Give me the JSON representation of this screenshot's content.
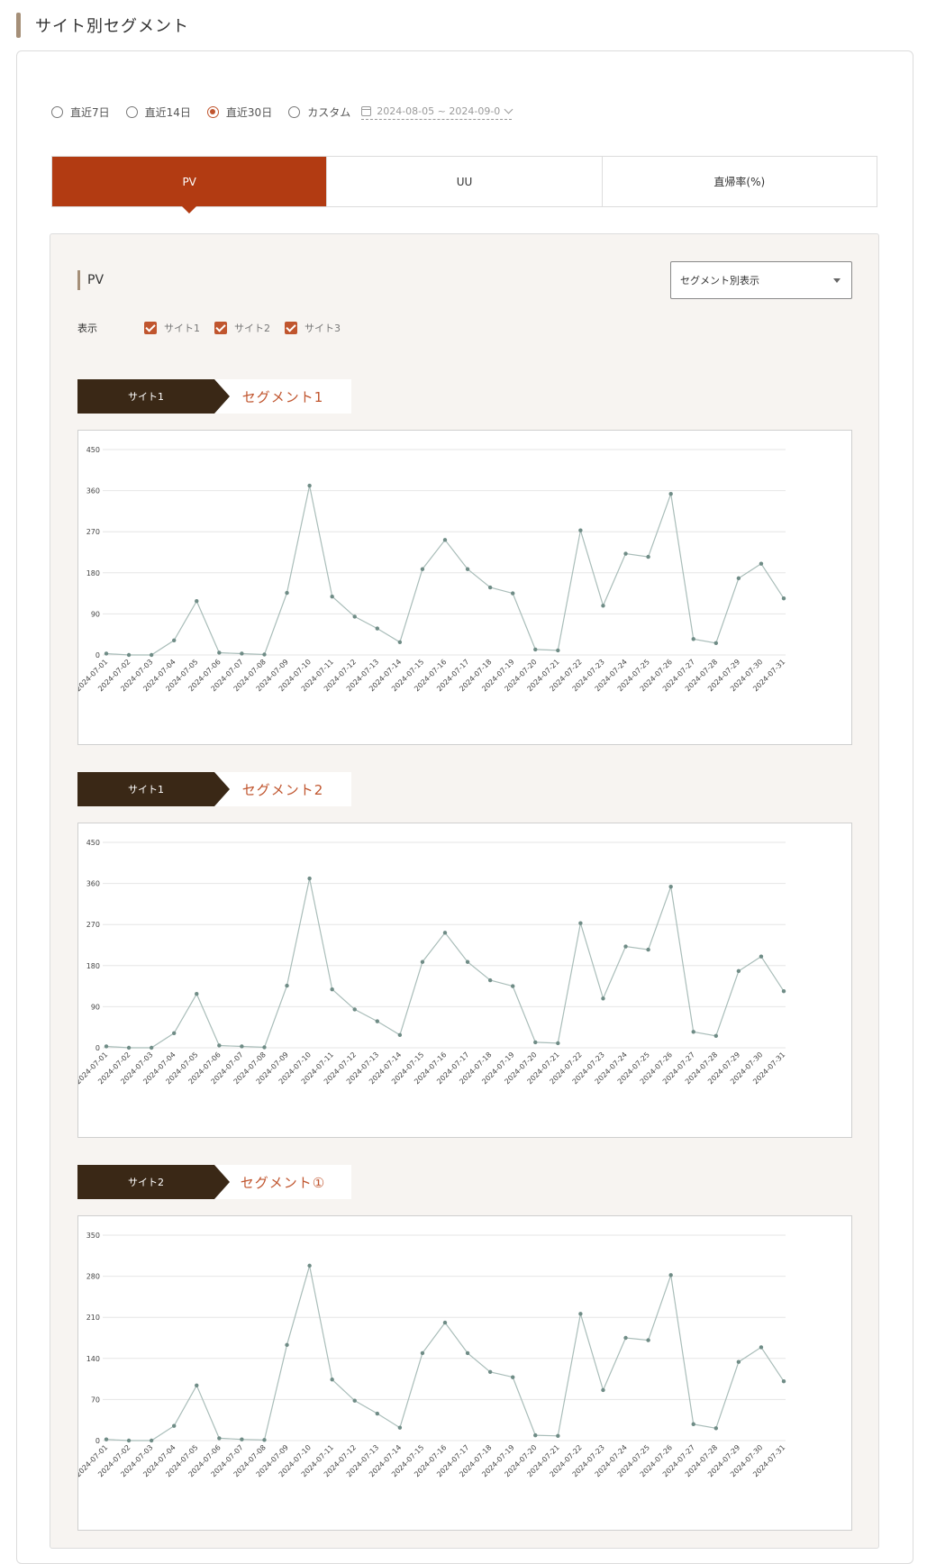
{
  "section_title": "サイト別セグメント",
  "period": {
    "options": [
      {
        "label": "直近7日",
        "selected": false
      },
      {
        "label": "直近14日",
        "selected": false
      },
      {
        "label": "直近30日",
        "selected": true
      },
      {
        "label": "カスタム",
        "selected": false
      }
    ],
    "date_range": "2024-08-05 ~ 2024-09-0"
  },
  "metric_tabs": [
    {
      "label": "PV",
      "active": true
    },
    {
      "label": "UU",
      "active": false
    },
    {
      "label": "直帰率(%)",
      "active": false
    }
  ],
  "panel": {
    "title": "PV",
    "view_select": "セグメント別表示",
    "display_label": "表示",
    "site_checks": [
      "サイト1",
      "サイト2",
      "サイト3"
    ]
  },
  "colors": {
    "accent": "#b23b12",
    "site_tag": "#3a2816",
    "segment_text": "#c0552e",
    "line": "#a9bdb9",
    "point": "#6f8c86"
  },
  "segments": [
    {
      "site": "サイト1",
      "segment": "セグメント1"
    },
    {
      "site": "サイト1",
      "segment": "セグメント2"
    },
    {
      "site": "サイト2",
      "segment": "セグメント①"
    }
  ],
  "chart_data": [
    {
      "type": "line",
      "x": [
        "2024-07-01",
        "2024-07-02",
        "2024-07-03",
        "2024-07-04",
        "2024-07-05",
        "2024-07-06",
        "2024-07-07",
        "2024-07-08",
        "2024-07-09",
        "2024-07-10",
        "2024-07-11",
        "2024-07-12",
        "2024-07-13",
        "2024-07-14",
        "2024-07-15",
        "2024-07-16",
        "2024-07-17",
        "2024-07-18",
        "2024-07-19",
        "2024-07-20",
        "2024-07-21",
        "2024-07-22",
        "2024-07-23",
        "2024-07-24",
        "2024-07-25",
        "2024-07-26",
        "2024-07-27",
        "2024-07-28",
        "2024-07-29",
        "2024-07-30",
        "2024-07-31"
      ],
      "values": [
        3,
        0,
        0,
        32,
        118,
        5,
        3,
        1,
        136,
        371,
        128,
        84,
        58,
        28,
        188,
        252,
        188,
        148,
        135,
        12,
        10,
        273,
        108,
        222,
        215,
        353,
        35,
        26,
        168,
        200,
        124
      ],
      "yticks": [
        0,
        90,
        180,
        270,
        360,
        450
      ],
      "ylim": [
        0,
        450
      ]
    },
    {
      "type": "line",
      "x": [
        "2024-07-01",
        "2024-07-02",
        "2024-07-03",
        "2024-07-04",
        "2024-07-05",
        "2024-07-06",
        "2024-07-07",
        "2024-07-08",
        "2024-07-09",
        "2024-07-10",
        "2024-07-11",
        "2024-07-12",
        "2024-07-13",
        "2024-07-14",
        "2024-07-15",
        "2024-07-16",
        "2024-07-17",
        "2024-07-18",
        "2024-07-19",
        "2024-07-20",
        "2024-07-21",
        "2024-07-22",
        "2024-07-23",
        "2024-07-24",
        "2024-07-25",
        "2024-07-26",
        "2024-07-27",
        "2024-07-28",
        "2024-07-29",
        "2024-07-30",
        "2024-07-31"
      ],
      "values": [
        3,
        0,
        0,
        32,
        118,
        5,
        3,
        1,
        136,
        371,
        128,
        84,
        58,
        28,
        188,
        252,
        188,
        148,
        135,
        12,
        10,
        273,
        108,
        222,
        215,
        353,
        35,
        26,
        168,
        200,
        124
      ],
      "yticks": [
        0,
        90,
        180,
        270,
        360,
        450
      ],
      "ylim": [
        0,
        450
      ]
    },
    {
      "type": "line",
      "x": [
        "2024-07-01",
        "2024-07-02",
        "2024-07-03",
        "2024-07-04",
        "2024-07-05",
        "2024-07-06",
        "2024-07-07",
        "2024-07-08",
        "2024-07-09",
        "2024-07-10",
        "2024-07-11",
        "2024-07-12",
        "2024-07-13",
        "2024-07-14",
        "2024-07-15",
        "2024-07-16",
        "2024-07-17",
        "2024-07-18",
        "2024-07-19",
        "2024-07-20",
        "2024-07-21",
        "2024-07-22",
        "2024-07-23",
        "2024-07-24",
        "2024-07-25",
        "2024-07-26",
        "2024-07-27",
        "2024-07-28",
        "2024-07-29",
        "2024-07-30",
        "2024-07-31"
      ],
      "values": [
        2,
        0,
        0,
        25,
        94,
        4,
        2,
        1,
        163,
        298,
        104,
        68,
        46,
        22,
        149,
        201,
        149,
        117,
        108,
        9,
        8,
        216,
        86,
        175,
        171,
        282,
        28,
        21,
        134,
        159,
        101
      ],
      "yticks": [
        0,
        70,
        140,
        210,
        280,
        350
      ],
      "ylim": [
        0,
        350
      ]
    }
  ]
}
